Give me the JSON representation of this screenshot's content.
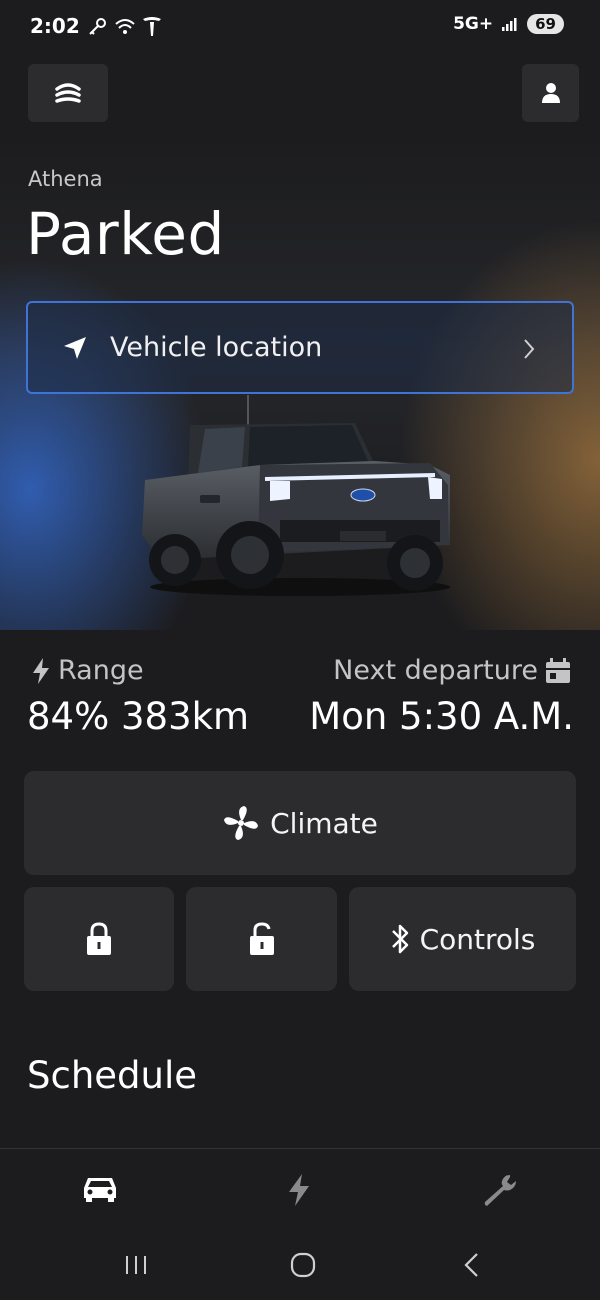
{
  "status_bar": {
    "time": "2:02",
    "network": "5G+",
    "battery": "69"
  },
  "header": {
    "vehicle_name": "Athena",
    "vehicle_state": "Parked"
  },
  "location": {
    "label": "Vehicle location"
  },
  "stats": {
    "range_label": "Range",
    "range_value": "84% 383km",
    "departure_label": "Next departure",
    "departure_value": "Mon 5:30 A.M."
  },
  "tiles": {
    "climate_label": "Climate",
    "controls_label": "Controls"
  },
  "schedule": {
    "title": "Schedule"
  },
  "icons": {
    "menu": "vehicle-menu-icon",
    "profile": "person-icon",
    "location": "location-arrow-icon",
    "chevron": "chevron-right-icon",
    "range": "lightning-icon",
    "departure": "calendar-icon",
    "climate": "fan-icon",
    "lock": "lock-closed-icon",
    "unlock": "lock-open-icon",
    "controls": "bluetooth-icon",
    "nav_vehicle": "car-icon",
    "nav_charge": "lightning-icon",
    "nav_service": "wrench-icon"
  },
  "colors": {
    "background": "#1c1c1e",
    "tile": "#2c2c2e",
    "accent_blue": "#3f74d6",
    "text_primary": "#ffffff",
    "text_secondary": "#c4c4c4"
  }
}
